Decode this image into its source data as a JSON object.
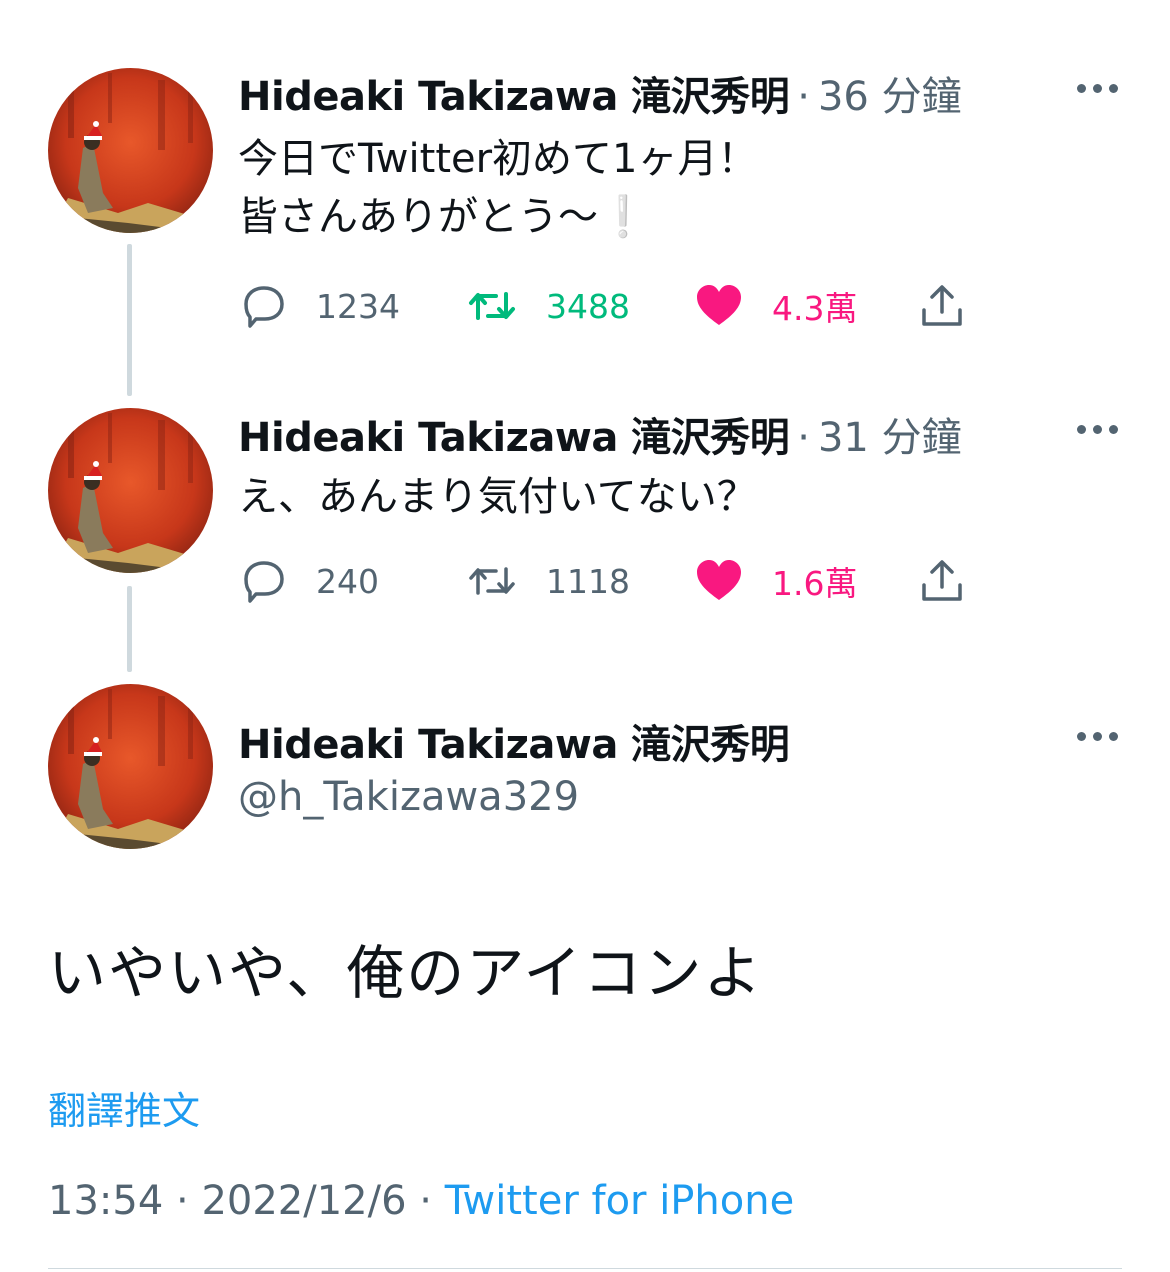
{
  "colors": {
    "text": "#0f1419",
    "secondary": "#536471",
    "link": "#1d9bf0",
    "retweet_active": "#00ba7c",
    "like_active": "#f91880",
    "thread_line": "#cfd9de"
  },
  "tweets": [
    {
      "display_name": "Hideaki Takizawa 滝沢秀明",
      "separator": "·",
      "time": "36 分鐘",
      "lines": [
        "今日でTwitter初めて1ヶ月！",
        "皆さんありがとう〜❕"
      ],
      "reply_count": "1234",
      "retweet_count": "3488",
      "like_count": "4.3萬",
      "retweeted": true,
      "liked": true
    },
    {
      "display_name": "Hideaki Takizawa 滝沢秀明",
      "separator": "·",
      "time": "31 分鐘",
      "lines": [
        "え、あんまり気付いてない？"
      ],
      "reply_count": "240",
      "retweet_count": "1118",
      "like_count": "1.6萬",
      "retweeted": false,
      "liked": true
    }
  ],
  "main_tweet": {
    "display_name": "Hideaki Takizawa 滝沢秀明",
    "handle": "@h_Takizawa329",
    "text": "いやいや、俺のアイコンよ",
    "translate_label": "翻譯推文",
    "time": "13:54",
    "date": "2022/12/6",
    "separator": "·",
    "source": "Twitter for iPhone"
  },
  "icons": {
    "reply": "reply-icon",
    "retweet": "retweet-icon",
    "like": "heart-icon",
    "share": "share-icon",
    "more": "more-icon"
  }
}
